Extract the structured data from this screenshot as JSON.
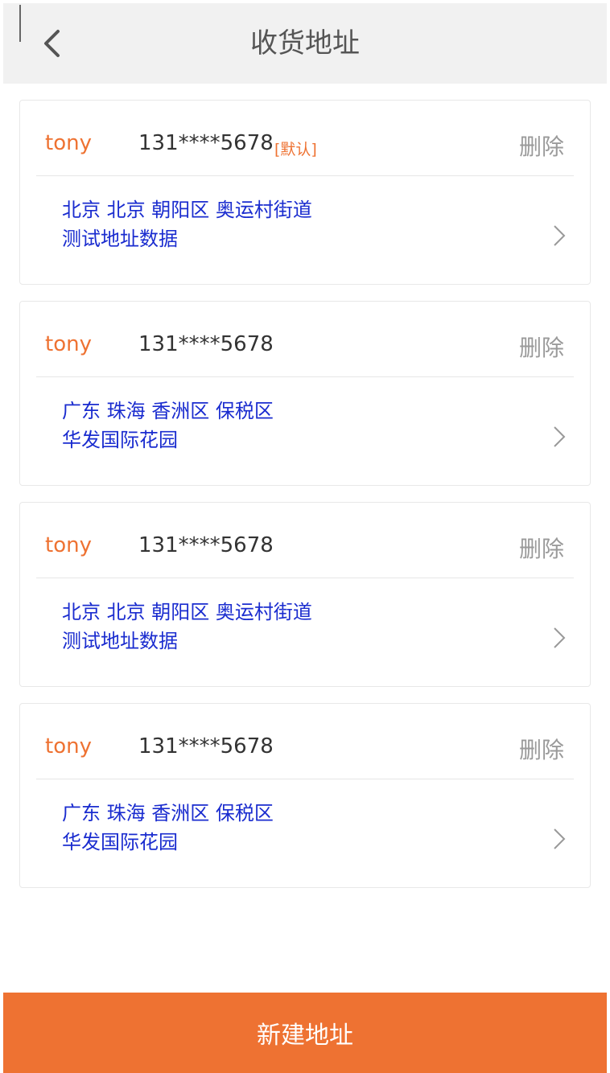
{
  "header": {
    "title": "收货地址",
    "back_icon": "chevron-left-icon"
  },
  "addresses": [
    {
      "name": "tony",
      "phone": "131****5678",
      "default_tag": "[默认]",
      "delete_label": "删除",
      "region": "北京 北京 朝阳区 奥运村街道",
      "detail": "测试地址数据"
    },
    {
      "name": "tony",
      "phone": "131****5678",
      "default_tag": "",
      "delete_label": "删除",
      "region": "广东 珠海 香洲区 保税区",
      "detail": "华发国际花园"
    },
    {
      "name": "tony",
      "phone": "131****5678",
      "default_tag": "",
      "delete_label": "删除",
      "region": "北京 北京 朝阳区 奥运村街道",
      "detail": "测试地址数据"
    },
    {
      "name": "tony",
      "phone": "131****5678",
      "default_tag": "",
      "delete_label": "删除",
      "region": "广东 珠海 香洲区 保税区",
      "detail": "华发国际花园"
    }
  ],
  "footer": {
    "new_address_label": "新建地址"
  },
  "colors": {
    "accent": "#ee7232",
    "address_text": "#1a2ccf",
    "header_bg": "#f1f1f1"
  }
}
